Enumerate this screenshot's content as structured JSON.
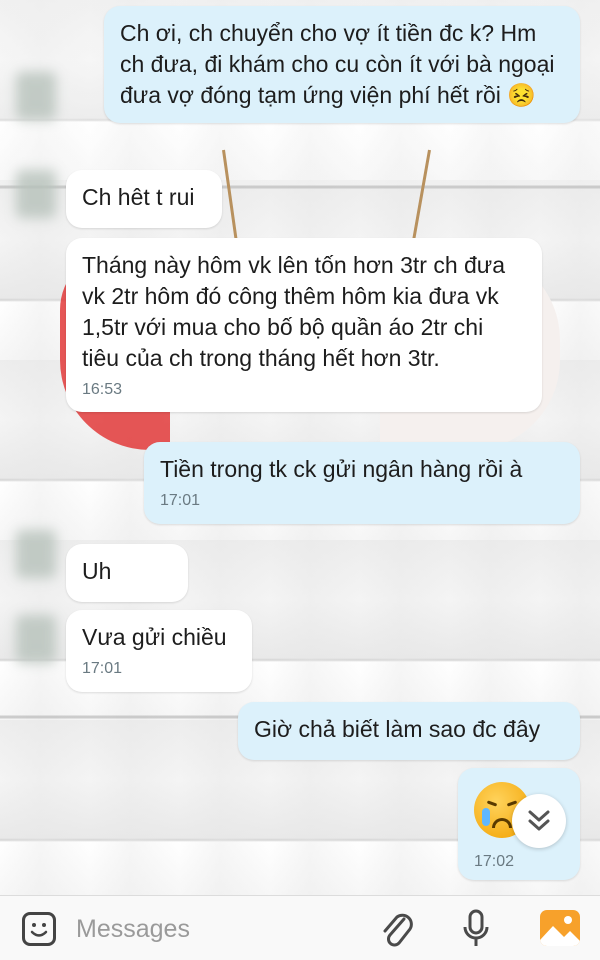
{
  "messages": [
    {
      "id": "m1",
      "side": "out",
      "text": "Ch ơi, ch chuyển cho vợ ít tiền đc k? Hm ch đưa, đi khám cho cu còn ít với bà ngoại đưa vợ đóng tạm ứng viện phí hết rồi 😣",
      "time": ""
    },
    {
      "id": "m2",
      "side": "in",
      "text": "Ch hêt t rui",
      "time": ""
    },
    {
      "id": "m3",
      "side": "in",
      "text": "Tháng này hôm vk lên tốn hơn 3tr ch đưa vk 2tr hôm đó công thêm hôm kia đưa vk 1,5tr với mua cho bố bộ quần áo 2tr chi tiêu của ch trong tháng hết hơn 3tr.",
      "time": "16:53"
    },
    {
      "id": "m4",
      "side": "out",
      "text": "Tiền trong tk ck gửi ngân hàng rồi à",
      "time": "17:01"
    },
    {
      "id": "m5",
      "side": "in",
      "text": "Uh",
      "time": ""
    },
    {
      "id": "m6",
      "side": "in",
      "text": "Vưa gửi chiều",
      "time": "17:01"
    },
    {
      "id": "m7",
      "side": "out",
      "text": "Giờ chả biết làm sao đc đây",
      "time": ""
    },
    {
      "id": "m8",
      "side": "out",
      "text": "",
      "emoji": "crying-face",
      "time": "17:02"
    }
  ],
  "input": {
    "placeholder": "Messages"
  },
  "icons": {
    "sticker": "sticker-icon",
    "attach": "paperclip-icon",
    "mic": "microphone-icon",
    "gallery": "gallery-icon",
    "scroll_down": "chevron-double-down-icon"
  },
  "colors": {
    "outgoing_bubble": "#dcf1fb",
    "incoming_bubble": "#ffffff",
    "gallery_accent": "#f7a12b"
  }
}
